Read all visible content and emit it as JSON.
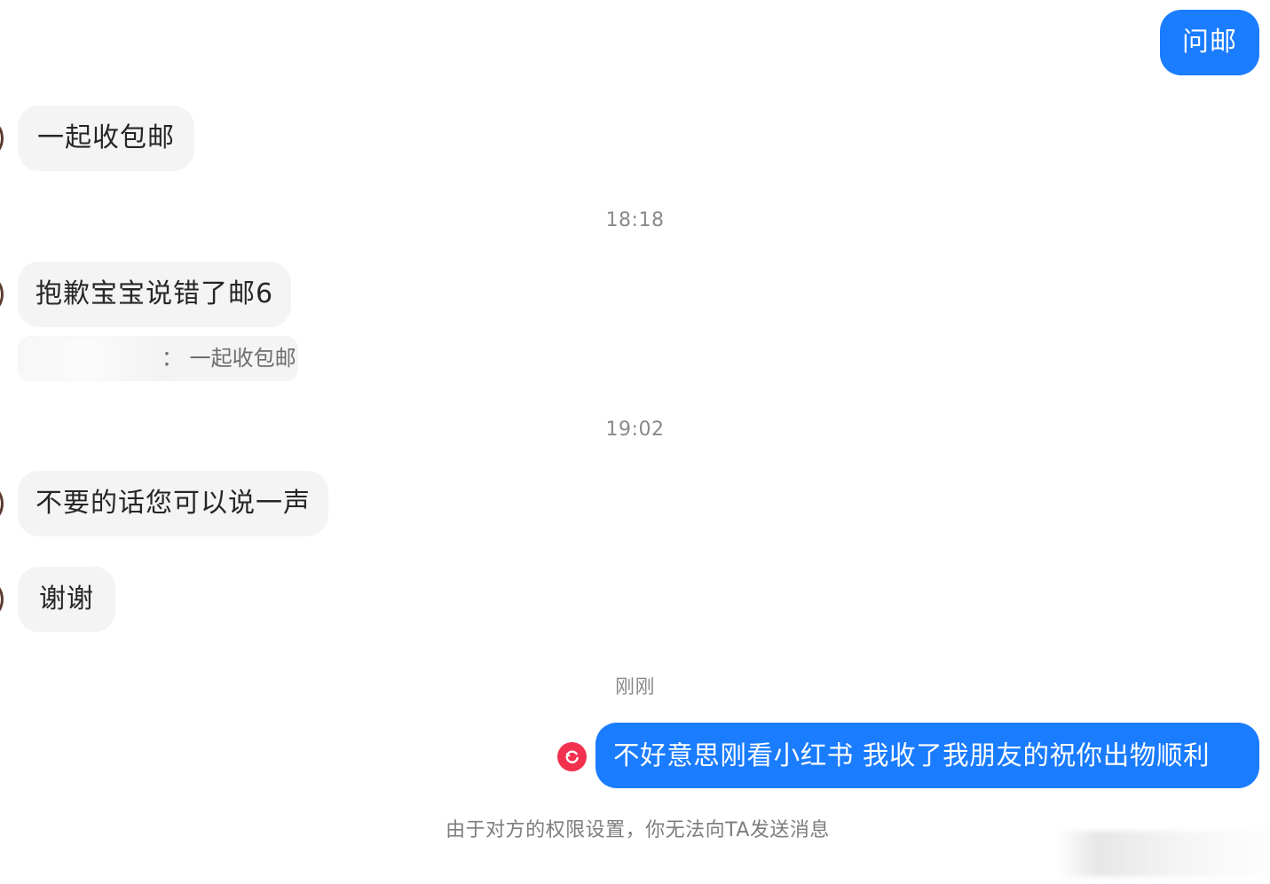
{
  "messages": {
    "m1": "问邮",
    "m2": "一起收包邮",
    "t1": "18:18",
    "m3": "抱歉宝宝说错了邮6",
    "m3_quote": "：  一起收包邮",
    "t2": "19:02",
    "m4": "不要的话您可以说一声",
    "m5": "谢谢",
    "t3": "刚刚",
    "m6": "不好意思刚看小红书 我收了我朋友的祝你出物顺利"
  },
  "notice": "由于对方的权限设置，你无法向TA发送消息",
  "colors": {
    "outgoing_bubble": "#1a7cff",
    "incoming_bubble": "#f4f4f4",
    "resend_icon": "#f2314f"
  },
  "icons": {
    "resend": "refresh-icon"
  }
}
